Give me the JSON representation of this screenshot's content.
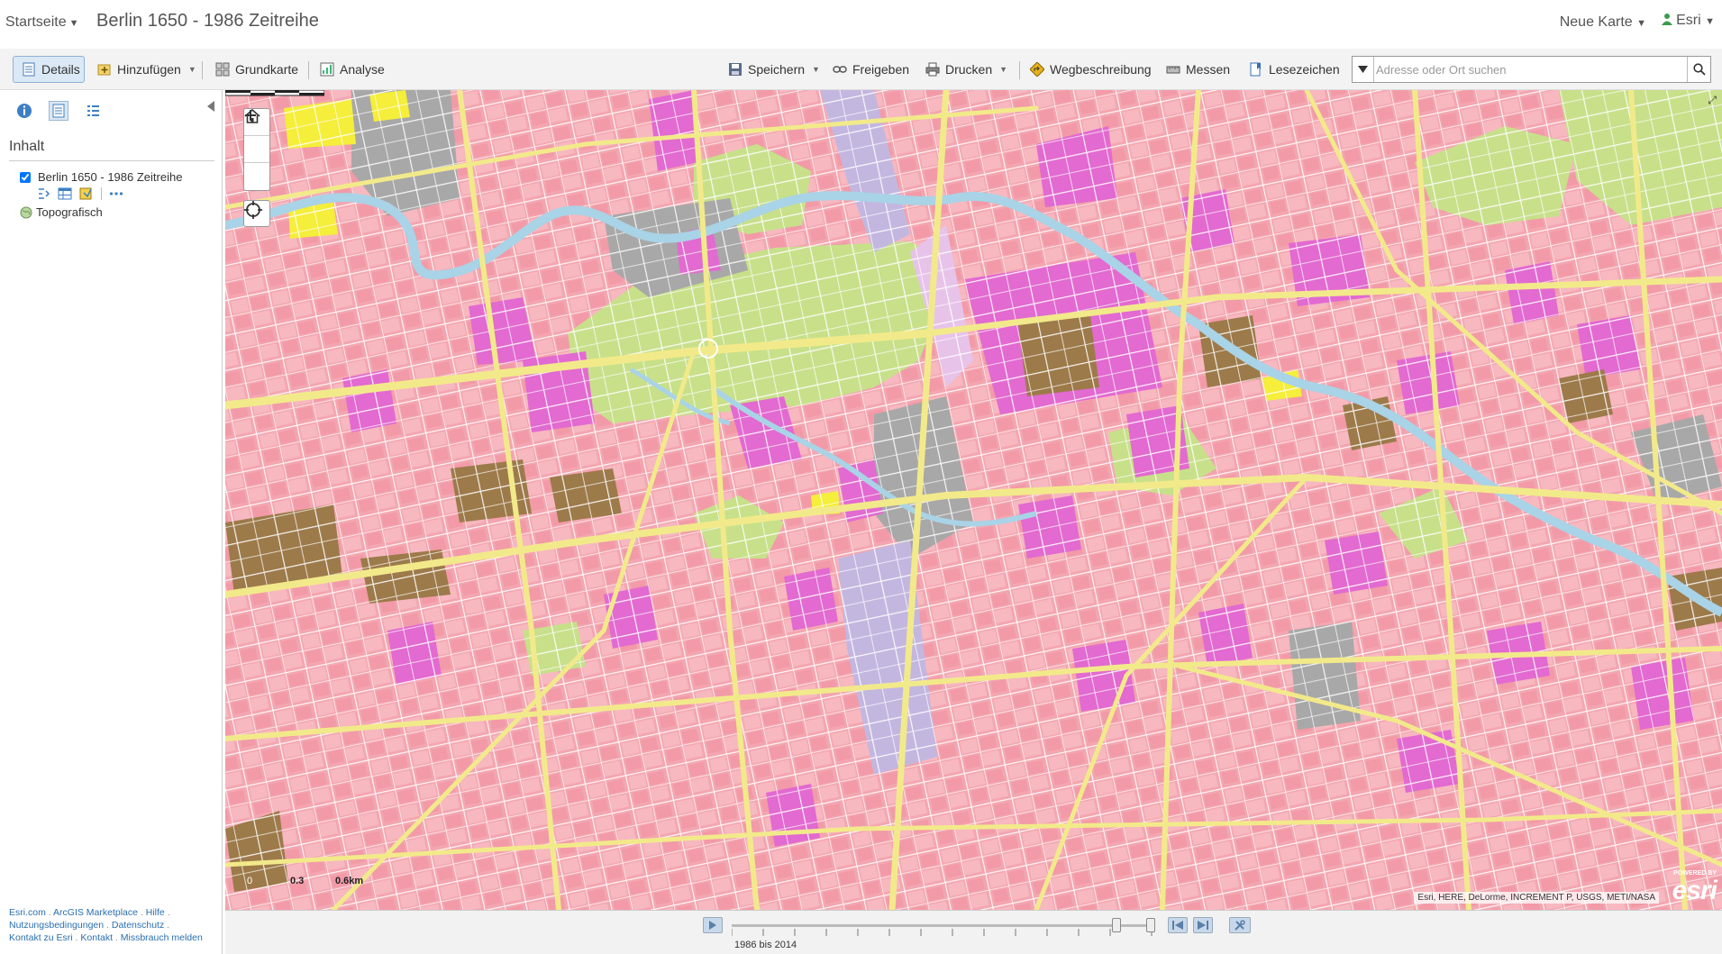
{
  "header": {
    "home_label": "Startseite",
    "title": "Berlin 1650 - 1986 Zeitreihe",
    "new_map_label": "Neue Karte",
    "user_label": "Esri"
  },
  "toolbar": {
    "details": "Details",
    "add": "Hinzufügen",
    "basemap": "Grundkarte",
    "analysis": "Analyse",
    "save": "Speichern",
    "share": "Freigeben",
    "print": "Drucken",
    "directions": "Wegbeschreibung",
    "measure": "Messen",
    "bookmarks": "Lesezeichen",
    "search_placeholder": "Adresse oder Ort suchen"
  },
  "panel": {
    "heading": "Inhalt",
    "layer_name": "Berlin 1650 - 1986 Zeitreihe",
    "basemap_name": "Topografisch",
    "footer_links": [
      "Esri.com",
      "ArcGIS Marketplace",
      "Hilfe",
      "Nutzungsbedingungen",
      "Datenschutz",
      "Kontakt zu Esri",
      "Kontakt",
      "Missbrauch melden"
    ]
  },
  "map": {
    "scale_labels": [
      "0",
      "0.3",
      "0.6km"
    ],
    "attribution": "Esri, HERE, DeLorme, INCREMENT P, USGS, METI/NASA",
    "logo_text": "esri",
    "powered_text": "POWERED BY",
    "colors": {
      "residential": "#f4a6b0",
      "commercial": "#e26ad0",
      "industrial": "#a8a8a8",
      "mixed": "#9d7a4a",
      "park": "#c8e08a",
      "road": "#f2ea8a",
      "water": "#a9d3e6",
      "rail": "#c3b7e0",
      "highlight": "#f5ee3a"
    }
  },
  "timeslider": {
    "label": "1986 bis 2014"
  }
}
